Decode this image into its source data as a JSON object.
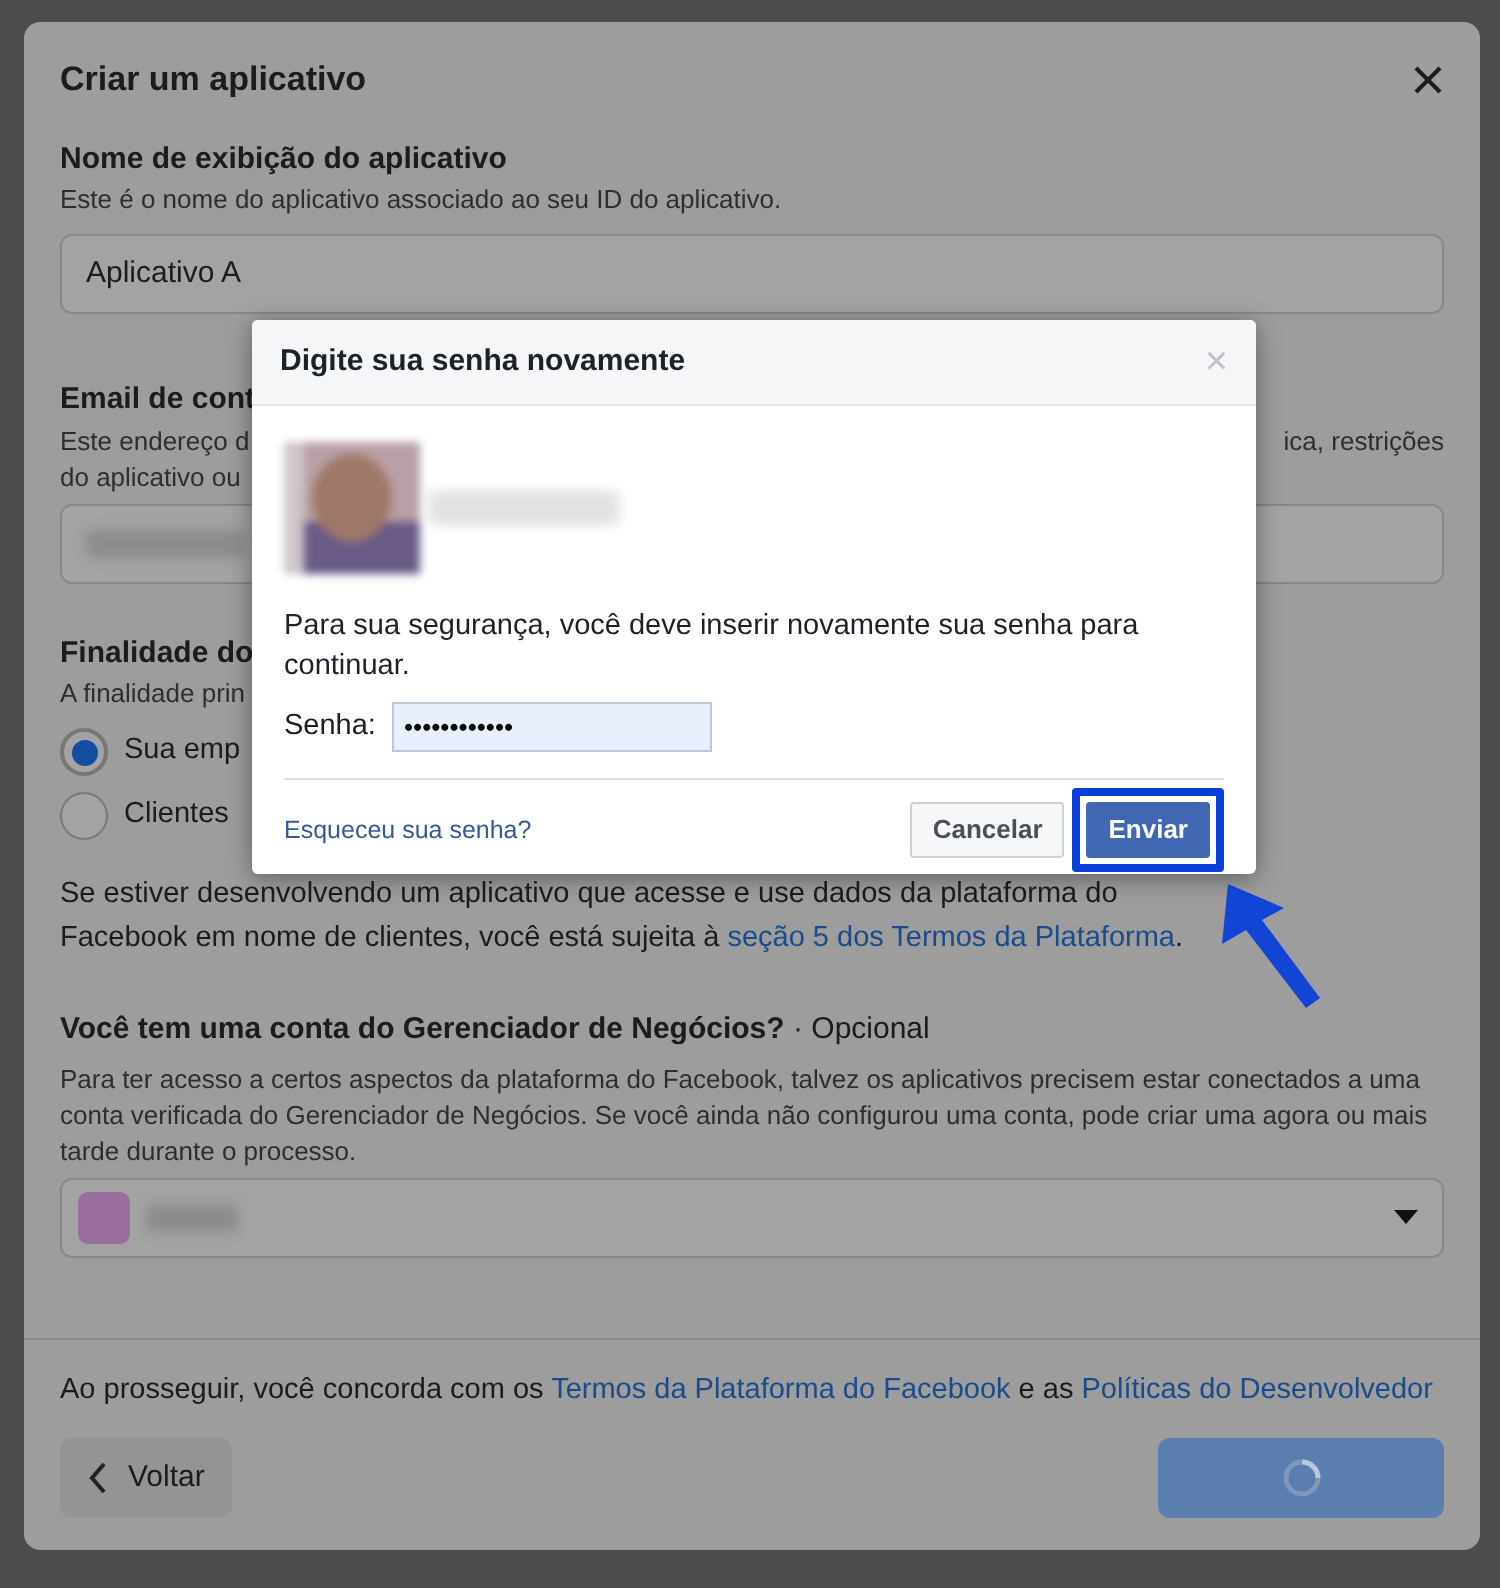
{
  "dialog": {
    "title": "Criar um aplicativo"
  },
  "app_name": {
    "label": "Nome de exibição do aplicativo",
    "help": "Este é o nome do aplicativo associado ao seu ID do aplicativo.",
    "value": "Aplicativo A"
  },
  "contact_email": {
    "label": "Email de cont",
    "help_left": [
      "Este endereço d",
      "do aplicativo ou"
    ],
    "help_right": "ica, restrições"
  },
  "purpose": {
    "label": "Finalidade do",
    "help": "A finalidade prin",
    "options": [
      {
        "label": "Sua emp",
        "selected": true
      },
      {
        "label": "Clientes",
        "selected": false
      }
    ],
    "note": "Se estiver desenvolvendo um aplicativo que acesse e use dados da plataforma do Facebook em nome de clientes, você está sujeita à ",
    "note_link": "seção 5 dos Termos da Plataforma",
    "note_end": "."
  },
  "business": {
    "label": "Você tem uma conta do Gerenciador de Negócios?",
    "optional": "· Opcional",
    "help": "Para ter acesso a certos aspectos da plataforma do Facebook, talvez os aplicativos precisem estar conectados a uma conta verificada do Gerenciador de Negócios. Se você ainda não configurou uma conta, pode criar uma agora ou mais tarde durante o processo."
  },
  "consent": {
    "before": "Ao prosseguir, você concorda com os ",
    "link1": "Termos da Plataforma do Facebook",
    "middle": " e as ",
    "link2": "Políticas do Desenvolvedor"
  },
  "back_button": "Voltar",
  "reauth_modal": {
    "title": "Digite sua senha novamente",
    "close": "×",
    "message": "Para sua segurança, você deve inserir novamente sua senha para continuar.",
    "password_label": "Senha:",
    "password_value": "••••••••••••",
    "forgot_link": "Esqueceu sua senha?",
    "cancel": "Cancelar",
    "submit": "Enviar"
  }
}
